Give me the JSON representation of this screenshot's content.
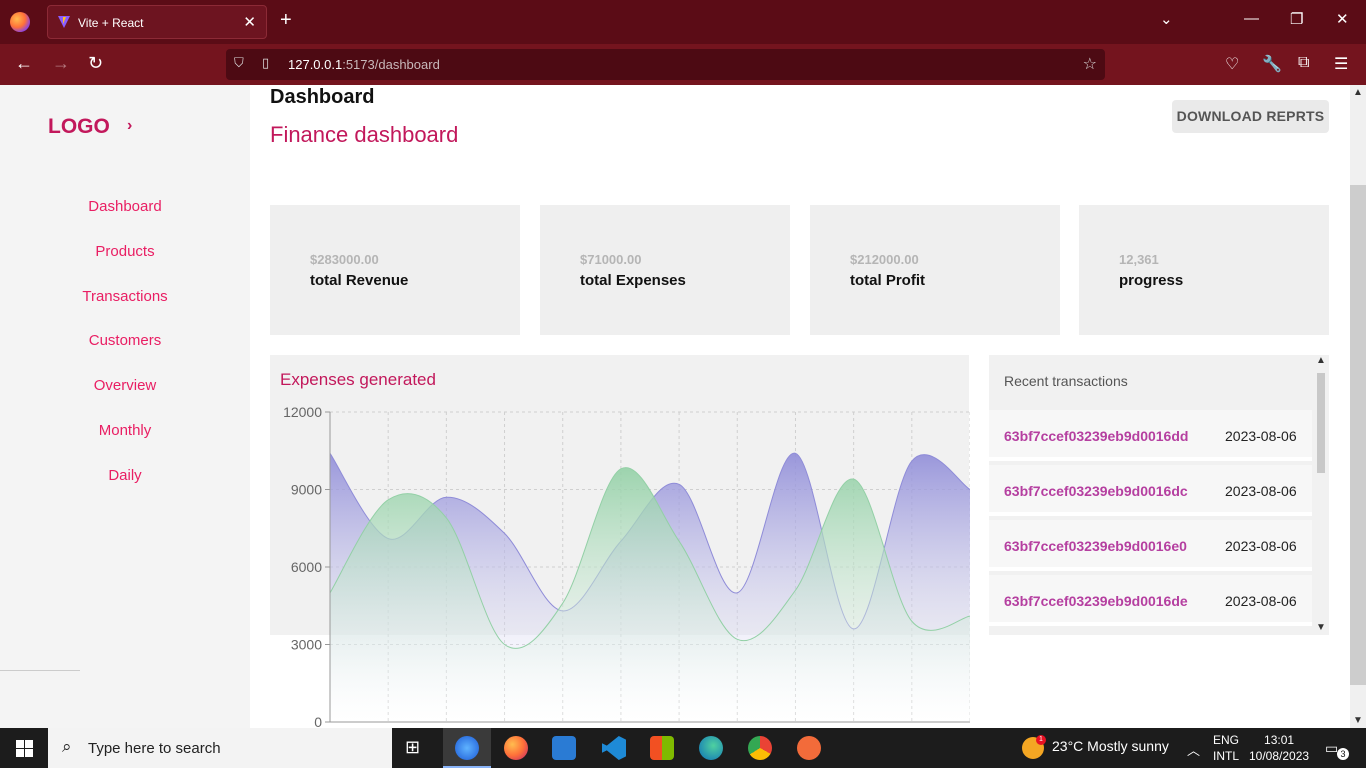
{
  "browser": {
    "tab_title": "Vite + React",
    "url_host": "127.0.0.1",
    "url_rest": ":5173/dashboard"
  },
  "sidebar": {
    "logo": "LOGO",
    "items": [
      "Dashboard",
      "Products",
      "Transactions",
      "Customers",
      "Overview",
      "Monthly",
      "Daily"
    ]
  },
  "header": {
    "title": "Dashboard",
    "subtitle": "Finance dashboard",
    "download_label": "DOWNLOAD REPRTS"
  },
  "stats": [
    {
      "value": "$283000.00",
      "label": "total Revenue"
    },
    {
      "value": "$71000.00",
      "label": "total Expenses"
    },
    {
      "value": "$212000.00",
      "label": "total Profit"
    },
    {
      "value": "12,361",
      "label": "progress"
    }
  ],
  "chart_data": {
    "type": "area",
    "title": "Expenses generated",
    "ylim": [
      0,
      12000
    ],
    "yticks": [
      "0",
      "3000",
      "6000",
      "9000",
      "12000"
    ],
    "x": [
      0,
      1,
      2,
      3,
      4,
      5,
      6,
      7,
      8,
      9,
      10,
      11
    ],
    "series": [
      {
        "values": [
          10400,
          7100,
          8700,
          7300,
          4300,
          7000,
          9200,
          5000,
          10400,
          3600,
          10100,
          9000
        ],
        "color": "#8f8cd8"
      },
      {
        "values": [
          5000,
          8600,
          7900,
          3000,
          4600,
          9800,
          7000,
          3200,
          5100,
          9400,
          3900,
          4100
        ],
        "color": "#93d0a6"
      }
    ],
    "grid": true
  },
  "transactions": {
    "heading": "Recent transactions",
    "rows": [
      {
        "id": "63bf7ccef03239eb9d0016dd",
        "date": "2023-08-06"
      },
      {
        "id": "63bf7ccef03239eb9d0016dc",
        "date": "2023-08-06"
      },
      {
        "id": "63bf7ccef03239eb9d0016e0",
        "date": "2023-08-06"
      },
      {
        "id": "63bf7ccef03239eb9d0016de",
        "date": "2023-08-06"
      }
    ]
  },
  "taskbar": {
    "search_placeholder": "Type here to search",
    "weather": "23°C  Mostly sunny",
    "lang1": "ENG",
    "lang2": "INTL",
    "time": "13:01",
    "date": "10/08/2023",
    "notif_count": "3"
  }
}
